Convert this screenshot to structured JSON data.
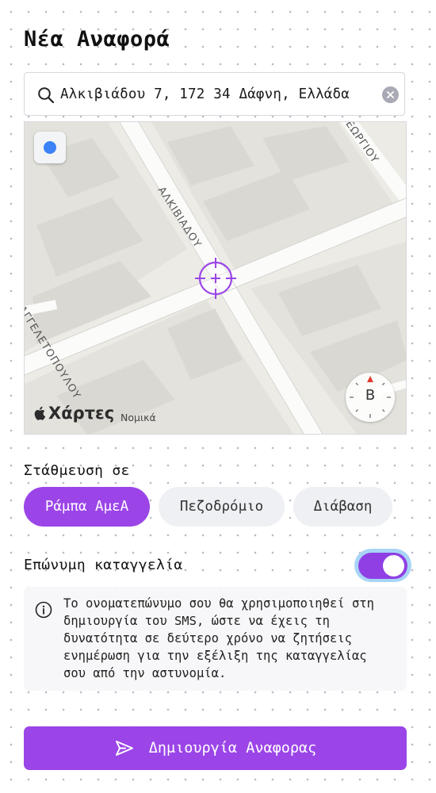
{
  "page": {
    "title": "Νέα Αναφορά"
  },
  "search": {
    "value": "Αλκιβιάδου 7, 172 34 Δάφνη, Ελλάδα",
    "search_icon": "search-icon",
    "clear_icon": "clear-icon"
  },
  "map": {
    "street_labels": [
      "ΑΛΚΙΒΙΑΔΟΥ",
      "ΓΕΩΡΓΙΟΥ",
      "ΑΓΓΕΛΕΤΟΠΟΥΛΟΥ"
    ],
    "brand": "Χάρτες",
    "legal": "Νομικά",
    "compass_letter": "Β",
    "location_button_icon": "location-dot-icon",
    "crosshair_icon": "crosshair-icon",
    "colors": {
      "land": "#ecebe6",
      "block": "#e1e0db",
      "building": "#d8d7d2",
      "road": "#fdfdfc",
      "location_dot": "#3b82f6",
      "crosshair": "#9b45e8"
    }
  },
  "parking": {
    "label": "Στάθμευση σε",
    "options": [
      "Ράμπα ΑμεΑ",
      "Πεζοδρόμιο",
      "Διάβαση"
    ],
    "selected": "Ράμπα ΑμεΑ"
  },
  "named_report": {
    "label": "Επώνυμη καταγγελία",
    "enabled": true
  },
  "info": {
    "icon": "info-icon",
    "text": "Το ονοματεπώνυμο σου θα χρησιμοποιηθεί στη\nδημιουργία του SMS, ώστε να έχεις τη\nδυνατότητα σε δεύτερο χρόνο να ζητήσεις\nενημέρωση για την εξέλιξη της καταγγελίας\nσου από την αστυνομία."
  },
  "submit": {
    "label": "Δημιουργία Αναφορας",
    "icon": "send-icon"
  },
  "colors": {
    "accent": "#9b45e8",
    "pill_inactive": "#eef0f3",
    "info_bg": "#f7f7f9",
    "toggle_focus_ring": "#a8d4f6"
  }
}
